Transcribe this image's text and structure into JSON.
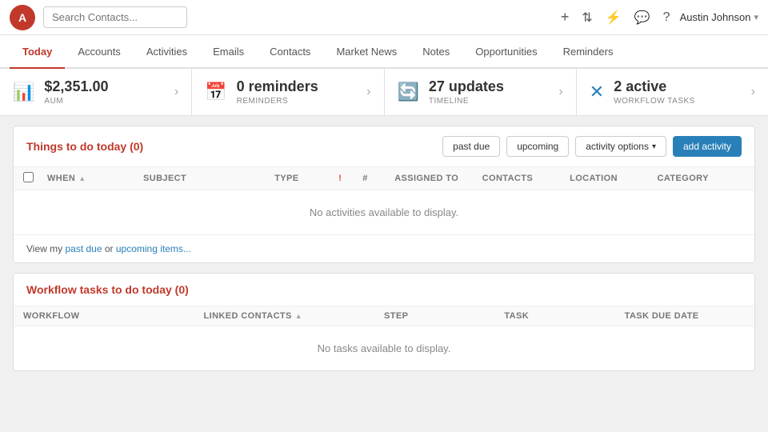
{
  "topNav": {
    "logoText": "A",
    "searchPlaceholder": "Search Contacts...",
    "icons": [
      "plus",
      "share",
      "filter",
      "chat",
      "help"
    ],
    "user": "Austin Johnson",
    "userChevron": "▾"
  },
  "tabs": [
    {
      "id": "today",
      "label": "Today",
      "active": true
    },
    {
      "id": "accounts",
      "label": "Accounts",
      "active": false
    },
    {
      "id": "activities",
      "label": "Activities",
      "active": false
    },
    {
      "id": "emails",
      "label": "Emails",
      "active": false
    },
    {
      "id": "contacts",
      "label": "Contacts",
      "active": false
    },
    {
      "id": "market-news",
      "label": "Market News",
      "active": false
    },
    {
      "id": "notes",
      "label": "Notes",
      "active": false
    },
    {
      "id": "opportunities",
      "label": "Opportunities",
      "active": false
    },
    {
      "id": "reminders",
      "label": "Reminders",
      "active": false
    }
  ],
  "summaryCards": [
    {
      "id": "aum",
      "icon": "📊",
      "iconColor": "#c0392b",
      "value": "$2,351.00",
      "label": "AUM"
    },
    {
      "id": "reminders",
      "icon": "📅",
      "iconColor": "#c0392b",
      "value": "0 reminders",
      "label": "REMINDERS"
    },
    {
      "id": "updates",
      "icon": "🔄",
      "iconColor": "#e67e22",
      "value": "27 updates",
      "label": "TIMELINE"
    },
    {
      "id": "workflow",
      "icon": "✕",
      "iconColor": "#2980b9",
      "value": "2 active",
      "label": "WORKFLOW TASKS"
    }
  ],
  "activitiesSection": {
    "title": "Things to do today (0)",
    "buttons": {
      "pastDue": "past due",
      "upcoming": "upcoming",
      "activityOptions": "activity options",
      "addActivity": "add activity"
    },
    "tableColumns": [
      "WHEN",
      "SUBJECT",
      "TYPE",
      "!",
      "#",
      "ASSIGNED TO",
      "CONTACTS",
      "LOCATION",
      "CATEGORY"
    ],
    "emptyMessage": "No activities available to display.",
    "footerPrefix": "View my ",
    "footerPastDue": "past due",
    "footerMiddle": " or ",
    "footerUpcoming": "upcoming items..."
  },
  "workflowSection": {
    "title": "Workflow tasks to do today (0)",
    "tableColumns": [
      "WORKFLOW",
      "LINKED CONTACTS",
      "STEP",
      "TASK",
      "TASK DUE DATE"
    ],
    "emptyMessage": "No tasks available to display."
  }
}
